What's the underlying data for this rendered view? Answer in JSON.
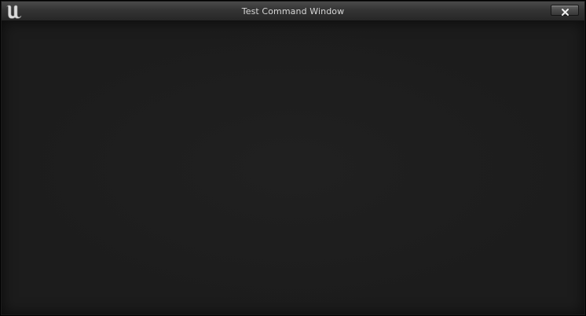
{
  "window": {
    "title": "Test Command Window",
    "logo_icon": "unreal-engine-logo-icon",
    "close_icon": "close-icon"
  },
  "colors": {
    "titlebar_top": "#4a4a4a",
    "titlebar_bottom": "#262626",
    "content_background": "#1c1c1c",
    "title_text": "#d6d6d6"
  }
}
